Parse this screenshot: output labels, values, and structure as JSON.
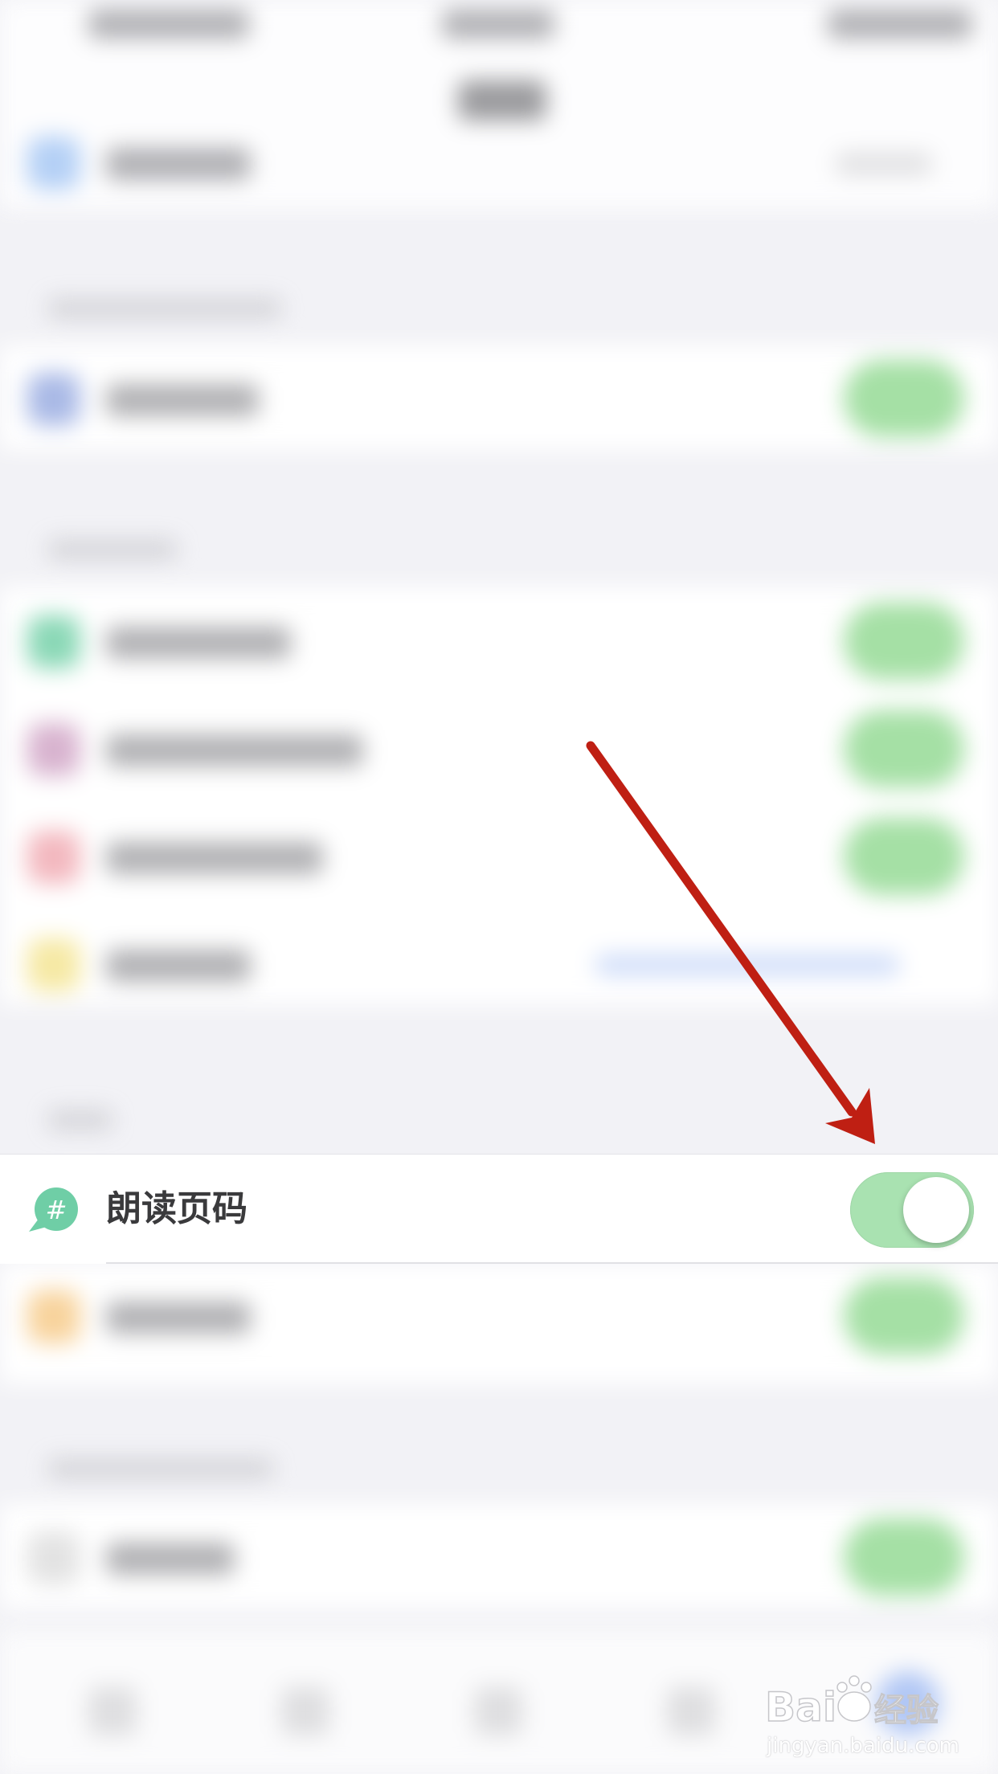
{
  "setting_row": {
    "label": "朗读页码",
    "icon": "hash-speech-bubble-icon",
    "toggle_on": true
  },
  "colors": {
    "icon_green": "#6fcea6",
    "toggle_track": "#a9e2b1",
    "annotation_arrow": "#bf1f13",
    "background": "#f2f2f6"
  },
  "watermark": {
    "brand": "Baidu经验",
    "url": "jingyan.baidu.com"
  }
}
